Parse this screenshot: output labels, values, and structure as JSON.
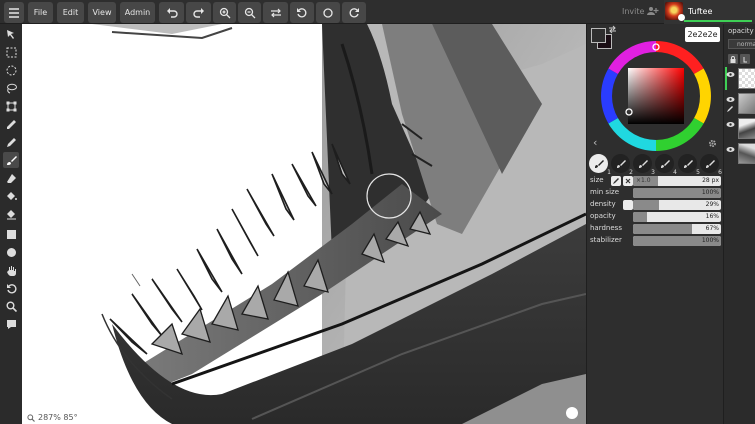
{
  "menu": {
    "file_label": "File",
    "edit_label": "Edit",
    "view_label": "View",
    "admin_label": "Admin"
  },
  "toolbar_icons": [
    "hamburger-icon",
    "undo-icon",
    "redo-icon",
    "zoom-in-icon",
    "zoom-out-icon",
    "flip-icon",
    "rotate-left-icon",
    "reset-rotation-icon",
    "rotate-right-icon"
  ],
  "user": {
    "invite_label": "Invite",
    "name": "Tuftee",
    "status_color": "#3ecf55"
  },
  "tools": [
    "select-arrow-icon",
    "rect-select-icon",
    "ellipse-select-icon",
    "lasso-icon",
    "transform-icon",
    "eyedropper-icon",
    "pen-icon",
    "brush-icon",
    "eraser-icon",
    "fill-bucket-icon",
    "gradient-fill-icon",
    "rectangle-icon",
    "ellipse-icon",
    "hand-icon",
    "rotate-view-icon",
    "zoom-icon",
    "comment-icon"
  ],
  "canvas": {
    "zoom_readout": "287% 85°"
  },
  "color": {
    "foreground": "#2e2e2e",
    "background": "#1a0d14",
    "hex_tooltip": "2e2e2e"
  },
  "brushes": {
    "numbers": [
      "1",
      "2",
      "3",
      "4",
      "5",
      "6"
    ],
    "active_index": 0
  },
  "brush_settings": {
    "size": {
      "label": "size",
      "modifier": "×1.0",
      "value": "28 px",
      "fraction": 0.28
    },
    "min_size": {
      "label": "min size",
      "value": "100%",
      "fraction": 1.0
    },
    "density": {
      "label": "density",
      "value": "29%",
      "fraction": 0.29
    },
    "opacity": {
      "label": "opacity",
      "value": "16%",
      "fraction": 0.16
    },
    "hardness": {
      "label": "hardness",
      "value": "67%",
      "fraction": 0.67
    },
    "stabilizer": {
      "label": "stabilizer",
      "value": "100%",
      "fraction": 1.0
    }
  },
  "layers_panel": {
    "opacity_label": "opacity",
    "blend_mode": "normal"
  }
}
